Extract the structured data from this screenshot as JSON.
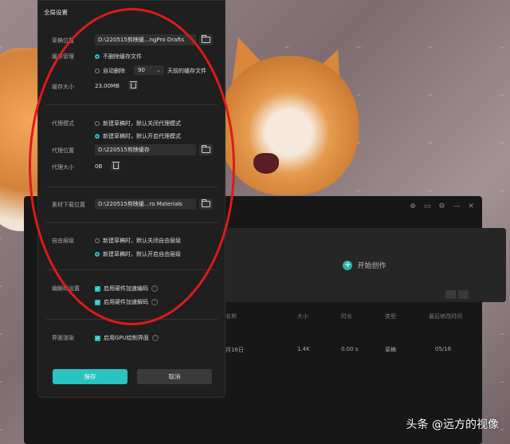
{
  "dialog": {
    "title": "全局设置",
    "drafts": {
      "label": "草稿位置",
      "path": "D:\\220515剪映缓...ngPro Drafts"
    },
    "cache": {
      "label": "缓存管理",
      "option_keep": "不删除缓存文件",
      "option_auto_prefix": "自动删除",
      "days": "90",
      "option_auto_suffix": "天前的缓存文件",
      "size_label": "缓存大小",
      "size_value": "23.00MB"
    },
    "proxy": {
      "mode_label": "代理模式",
      "option_off": "新建草稿时，默认关闭代理模式",
      "option_on": "新建草稿时，默认开启代理模式",
      "location_label": "代理位置",
      "path": "D:\\220515剪映缓存",
      "size_label": "代理大小",
      "size_value": "0B"
    },
    "materials": {
      "label": "素材下载位置",
      "path": "D:\\220515剪映缓...ro Materials"
    },
    "layers": {
      "label": "自由层级",
      "option_off": "新建草稿时，默认关闭自由层级",
      "option_on": "新建草稿时，默认开启自由层级"
    },
    "codec": {
      "label": "编解码设置",
      "hw_encode": "启用硬件加速编码",
      "hw_decode": "启用硬件加速解码"
    },
    "render": {
      "label": "界面渲染",
      "gpu": "启用GPU绘制界面"
    },
    "save_label": "保存",
    "cancel_label": "取消",
    "accent": "#2bc2c2"
  },
  "background_app": {
    "create_label": "开始创作",
    "columns": [
      "名称",
      "大小",
      "时长",
      "类型",
      "最后修改时间"
    ],
    "row": {
      "date": "月16日",
      "size": "1.4K",
      "duration": "0.00 s",
      "type": "草稿",
      "modified": "05/16"
    }
  },
  "annotation_color": "#e01a1a",
  "watermark": "头条 @远方的视像"
}
